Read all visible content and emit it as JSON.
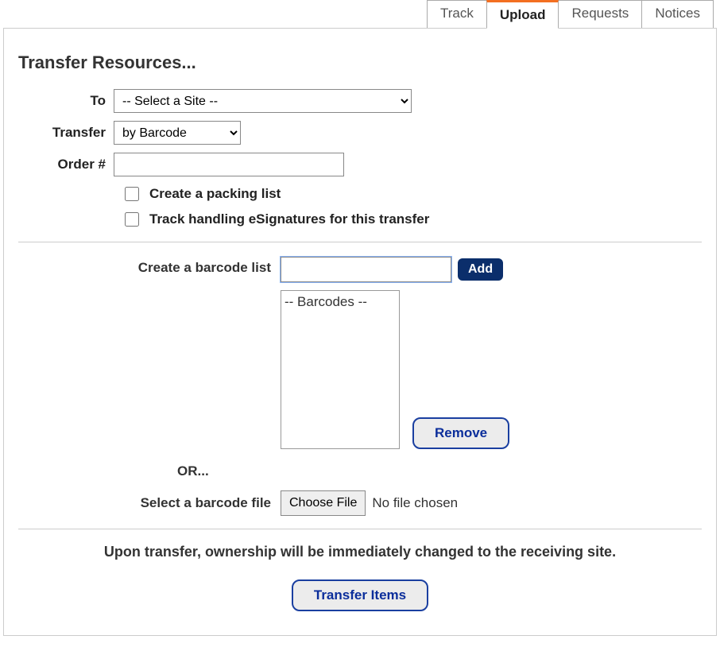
{
  "tabs": {
    "track": "Track",
    "upload": "Upload",
    "requests": "Requests",
    "notices": "Notices"
  },
  "title": "Transfer Resources...",
  "labels": {
    "to": "To",
    "transfer": "Transfer",
    "order": "Order #",
    "packing": "Create a packing list",
    "esign": "Track handling eSignatures for this transfer",
    "createBarcode": "Create a barcode list",
    "or": "OR...",
    "selectFile": "Select a barcode file"
  },
  "selects": {
    "siteValue": "-- Select a Site --",
    "transferValue": "by Barcode"
  },
  "inputs": {
    "orderValue": "",
    "barcodeValue": ""
  },
  "buttons": {
    "add": "Add",
    "remove": "Remove",
    "chooseFile": "Choose File",
    "transferItems": "Transfer Items"
  },
  "listPlaceholder": "-- Barcodes --",
  "fileStatus": "No file chosen",
  "notice": "Upon transfer, ownership will be immediately changed to the receiving site."
}
